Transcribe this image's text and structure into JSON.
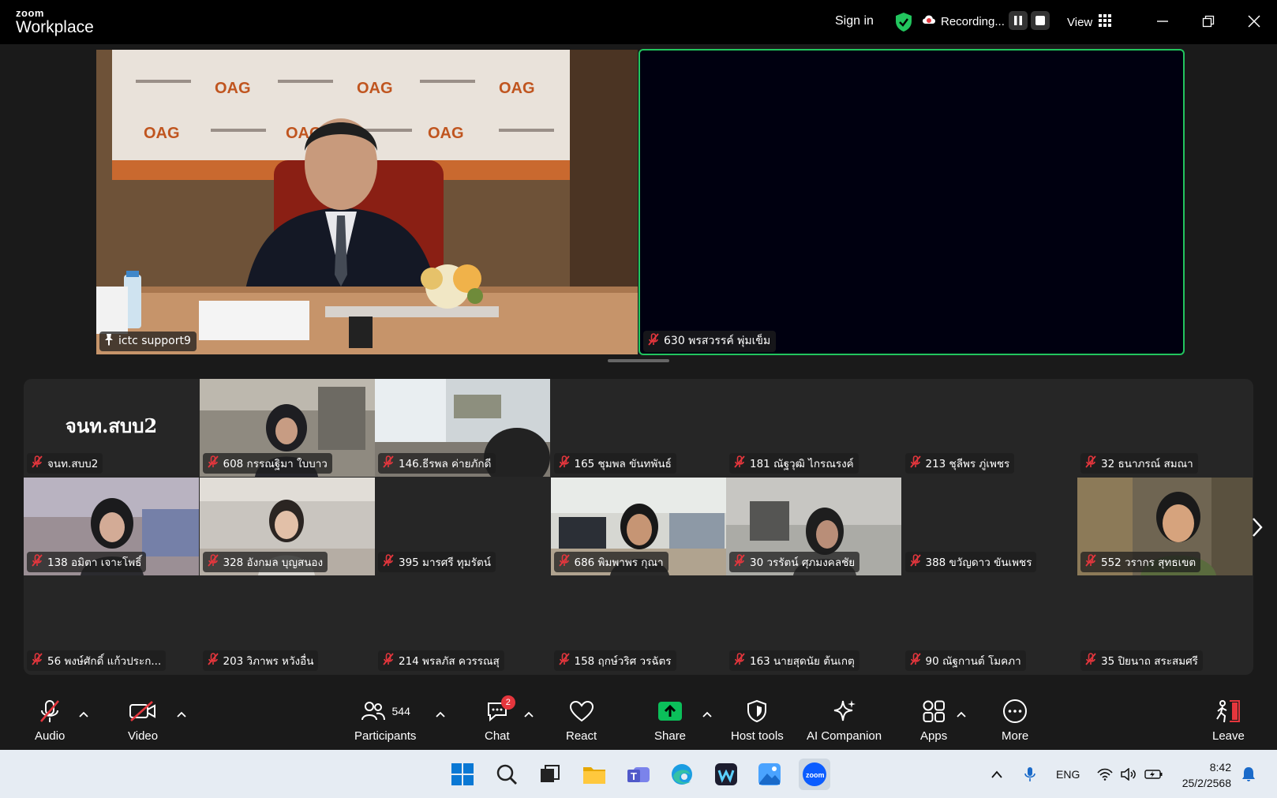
{
  "titlebar": {
    "brand_top": "zoom",
    "brand_bottom": "Workplace",
    "sign_in": "Sign in",
    "recording": "Recording...",
    "view": "View"
  },
  "spotlight": [
    {
      "name": "ictc support9",
      "status_icon": "pin-icon"
    },
    {
      "name": "630 พรสวรรค์ พุ่มเข็ม",
      "status_icon": "mic-muted-icon",
      "active_speaker": true
    }
  ],
  "gallery": {
    "self_tile_text": "จนท.สบบ2",
    "tiles": [
      {
        "name": "จนท.สบบ2",
        "video": false
      },
      {
        "name": "608 กรรณฐิมา ใบบาว",
        "video": true
      },
      {
        "name": "146.ธีรพล ค่ายภักดี",
        "video": true
      },
      {
        "name": "165 ชุมพล ขันทพันธ์",
        "video": false
      },
      {
        "name": "181 ณัฐวุฒิ  ไกรณรงค์",
        "video": false
      },
      {
        "name": "213 ชุลีพร ภู่เพชร",
        "video": false
      },
      {
        "name": "32 ธนาภรณ์ สมณา",
        "video": false
      },
      {
        "name": "138 อมิตา เจาะโพธิ์",
        "video": true
      },
      {
        "name": "328 อังกมล บุญสนอง",
        "video": true
      },
      {
        "name": "395 มารศรี ทุมรัตน์",
        "video": false
      },
      {
        "name": "686 พิมพาพร กุณา",
        "video": true
      },
      {
        "name": "30 วรรัตน์ ศุภมงคลชัย",
        "video": true
      },
      {
        "name": "388 ขวัญดาว ขันเพชร",
        "video": false
      },
      {
        "name": "552 วรากร สุทธเขต",
        "video": true
      },
      {
        "name": "56 พงษ์ศักดิ์ แก้วประก...",
        "video": false
      },
      {
        "name": "203 วิภาพร หวังอื่น",
        "video": false
      },
      {
        "name": "214 พรลภัส ควรรณสุ",
        "video": false
      },
      {
        "name": "158 ฤกษ์วริศ วรฉัตร",
        "video": false
      },
      {
        "name": "163 นายสุดนัย ต้นเกตุ",
        "video": false
      },
      {
        "name": "90 ณัฐกานต์ โมคภา",
        "video": false
      },
      {
        "name": "35 ปิยนาถ สระสมศรี",
        "video": false
      }
    ]
  },
  "toolbar": {
    "audio": "Audio",
    "video": "Video",
    "participants": "Participants",
    "participants_count": "544",
    "chat": "Chat",
    "chat_badge": "2",
    "react": "React",
    "share": "Share",
    "host_tools": "Host tools",
    "ai_companion": "AI Companion",
    "apps": "Apps",
    "more": "More",
    "leave": "Leave"
  },
  "taskbar": {
    "language": "ENG",
    "time": "8:42",
    "date": "25/2/2568"
  },
  "colors": {
    "active_speaker_border": "#22c55e",
    "muted_red": "#e5363d",
    "share_green": "#0bbf5a",
    "background": "#1a1a1a",
    "tile": "#262626"
  }
}
